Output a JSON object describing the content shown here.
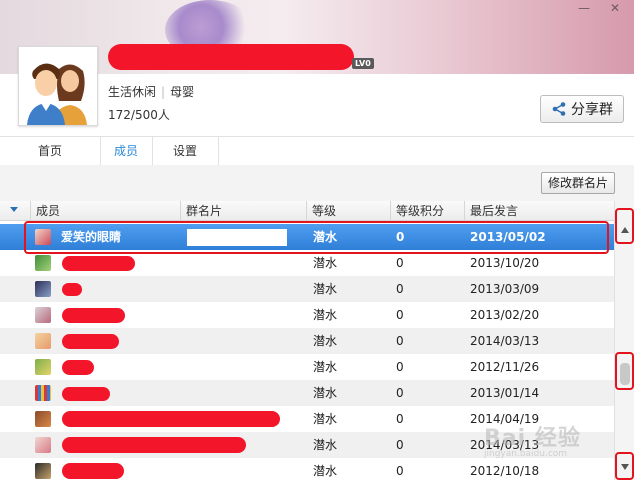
{
  "window": {
    "minimize_glyph": "—",
    "close_glyph": "✕"
  },
  "profile": {
    "level_badge": "LV0",
    "category": "生活休闲",
    "subcategory": "母婴",
    "member_count": "172/500人",
    "share_label": "分享群"
  },
  "tabs": [
    {
      "label": "首页",
      "active": false
    },
    {
      "label": "成员",
      "active": true
    },
    {
      "label": "设置",
      "active": false
    }
  ],
  "toolbar": {
    "edit_card_label": "修改群名片"
  },
  "table": {
    "columns": [
      "成员",
      "群名片",
      "等级",
      "等级积分",
      "最后发言"
    ],
    "rows": [
      {
        "member": "爱笑的眼睛",
        "card": "",
        "level": "潜水",
        "points": "0",
        "last": "2013/05/02",
        "selected": true
      },
      {
        "member": "",
        "card": "",
        "level": "潜水",
        "points": "0",
        "last": "2013/10/20"
      },
      {
        "member": "",
        "card": "",
        "level": "潜水",
        "points": "0",
        "last": "2013/03/09"
      },
      {
        "member": "",
        "card": "",
        "level": "潜水",
        "points": "0",
        "last": "2013/02/20"
      },
      {
        "member": "",
        "card": "",
        "level": "潜水",
        "points": "0",
        "last": "2014/03/13"
      },
      {
        "member": "",
        "card": "",
        "level": "潜水",
        "points": "0",
        "last": "2012/11/26"
      },
      {
        "member": "",
        "card": "",
        "level": "潜水",
        "points": "0",
        "last": "2013/01/14"
      },
      {
        "member": "",
        "card": "",
        "level": "潜水",
        "points": "0",
        "last": "2014/04/19"
      },
      {
        "member": "",
        "card": "",
        "level": "潜水",
        "points": "0",
        "last": "2014/03/13"
      },
      {
        "member": "",
        "card": "",
        "level": "潜水",
        "points": "0",
        "last": "2012/10/18"
      }
    ]
  },
  "watermark": {
    "text": "Bai 经验",
    "sub": "jingyan.baidu.com"
  },
  "colors": {
    "accent": "#2c8ad8",
    "selection": "#3a8be0",
    "annotation": "#e2141e",
    "redaction": "#f3162a"
  }
}
